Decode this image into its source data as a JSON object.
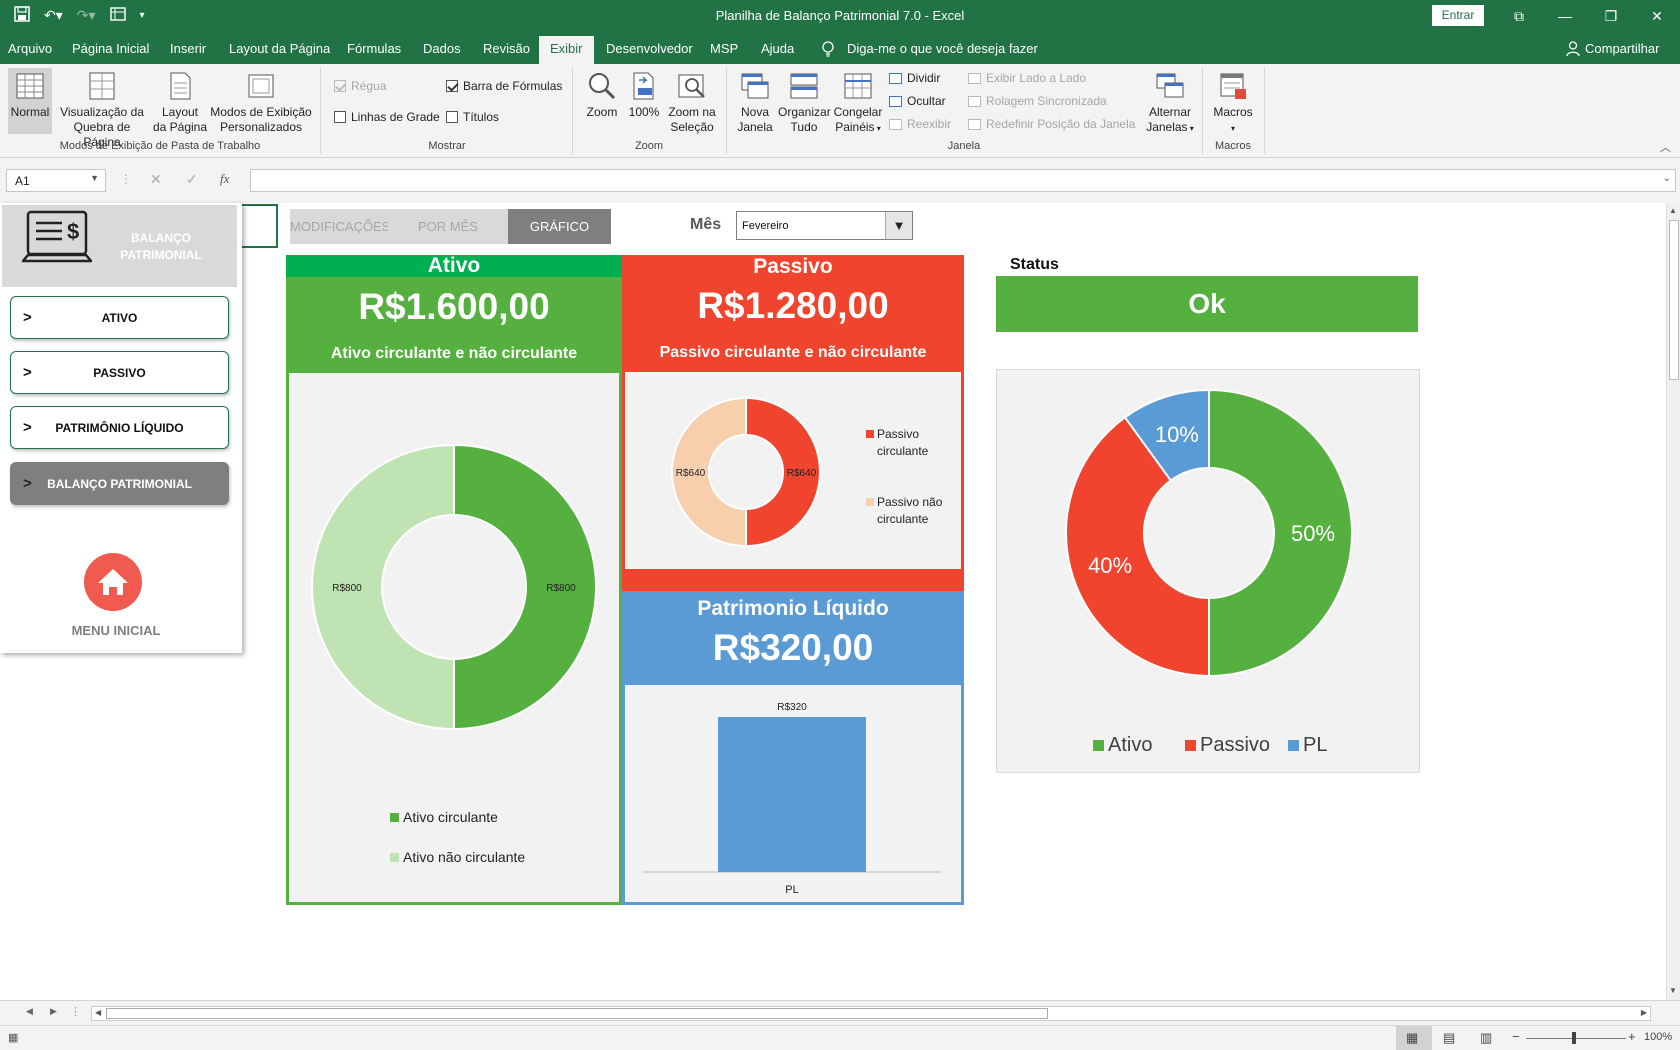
{
  "window": {
    "title": "Planilha de Balanço Patrimonial 7.0  -  Excel",
    "signin": "Entrar",
    "controls": [
      "⧉",
      "—",
      "❐",
      "✕"
    ]
  },
  "menu": {
    "tabs": [
      "Arquivo",
      "Página Inicial",
      "Inserir",
      "Layout da Página",
      "Fórmulas",
      "Dados",
      "Revisão",
      "Exibir",
      "Desenvolvedor",
      "MSP",
      "Ajuda"
    ],
    "active": "Exibir",
    "tell_me": "Diga-me o que você deseja fazer",
    "share": "Compartilhar"
  },
  "ribbon": {
    "views": {
      "normal": "Normal",
      "page_break": [
        "Visualização da",
        "Quebra de Página"
      ],
      "page_layout": [
        "Layout",
        "da Página"
      ],
      "custom": [
        "Modos de Exibição",
        "Personalizados"
      ],
      "group": "Modos de Exibição de Pasta de Trabalho"
    },
    "show": {
      "ruler": "Régua",
      "formula_bar": "Barra de Fórmulas",
      "gridlines": "Linhas de Grade",
      "headings": "Títulos",
      "group": "Mostrar"
    },
    "zoom": {
      "zoom": "Zoom",
      "hundred": "100%",
      "selection": [
        "Zoom na",
        "Seleção"
      ],
      "group": "Zoom"
    },
    "window": {
      "new": [
        "Nova",
        "Janela"
      ],
      "arrange": [
        "Organizar",
        "Tudo"
      ],
      "freeze": [
        "Congelar",
        "Painéis"
      ],
      "split": "Dividir",
      "hide": "Ocultar",
      "unhide": "Reexibir",
      "side_by_side": "Exibir Lado a Lado",
      "sync_scroll": "Rolagem Sincronizada",
      "reset_position": "Redefinir Posição da Janela",
      "switch": [
        "Alternar",
        "Janelas"
      ],
      "group": "Janela"
    },
    "macros": {
      "macros": "Macros",
      "group": "Macros"
    }
  },
  "formula_bar": {
    "name_box": "A1",
    "fx": "fx",
    "content": ""
  },
  "side_menu": {
    "title": [
      "BALANÇO",
      "PATRIMONIAL"
    ],
    "items": [
      "ATIVO",
      "PASSIVO",
      "PATRIMÔNIO LÍQUIDO",
      "BALANÇO PATRIMONIAL"
    ],
    "active": "BALANÇO PATRIMONIAL",
    "home": "MENU INICIAL"
  },
  "dashboard": {
    "tabs": [
      "MODIFICAÇÕES",
      "POR MÊS",
      "GRÁFICO"
    ],
    "active_tab": "GRÁFICO",
    "month_label": "Mês",
    "month_value": "Fevereiro",
    "ativo": {
      "title": "Ativo",
      "value": "R$1.600,00",
      "subtitle": "Ativo circulante e não circulante"
    },
    "passivo": {
      "title": "Passivo",
      "value": "R$1.280,00",
      "subtitle": "Passivo circulante e não circulante"
    },
    "pl": {
      "title": "Patrimonio Líquido",
      "value": "R$320,00"
    },
    "status": {
      "label": "Status",
      "value": "Ok"
    }
  },
  "colors": {
    "excel_green": "#217346",
    "ativo": "#55b03f",
    "ativo_light": "#c0e3b4",
    "ativo_header": "#00b050",
    "passivo": "#f0442f",
    "passivo_light": "#f8cfac",
    "pl": "#5b9bd5"
  },
  "chart_data": [
    {
      "type": "pie",
      "donut": true,
      "categories": [
        "Ativo circulante",
        "Ativo não circulante"
      ],
      "values": [
        800,
        800
      ],
      "data_labels": [
        "R$800",
        "R$800"
      ],
      "legend": "bottom"
    },
    {
      "type": "pie",
      "donut": true,
      "categories": [
        "Passivo circulante",
        "Passivo não circulante"
      ],
      "values": [
        640,
        640
      ],
      "data_labels": [
        "R$640",
        "R$640"
      ],
      "legend": "right"
    },
    {
      "type": "bar",
      "categories": [
        "PL"
      ],
      "values": [
        320
      ],
      "data_labels": [
        "R$320"
      ]
    },
    {
      "type": "pie",
      "donut": true,
      "categories": [
        "Ativo",
        "Passivo",
        "PL"
      ],
      "values": [
        50,
        40,
        10
      ],
      "data_labels": [
        "50%",
        "40%",
        "10%"
      ],
      "legend": "bottom"
    }
  ],
  "statusbar": {
    "zoom": "100%"
  }
}
